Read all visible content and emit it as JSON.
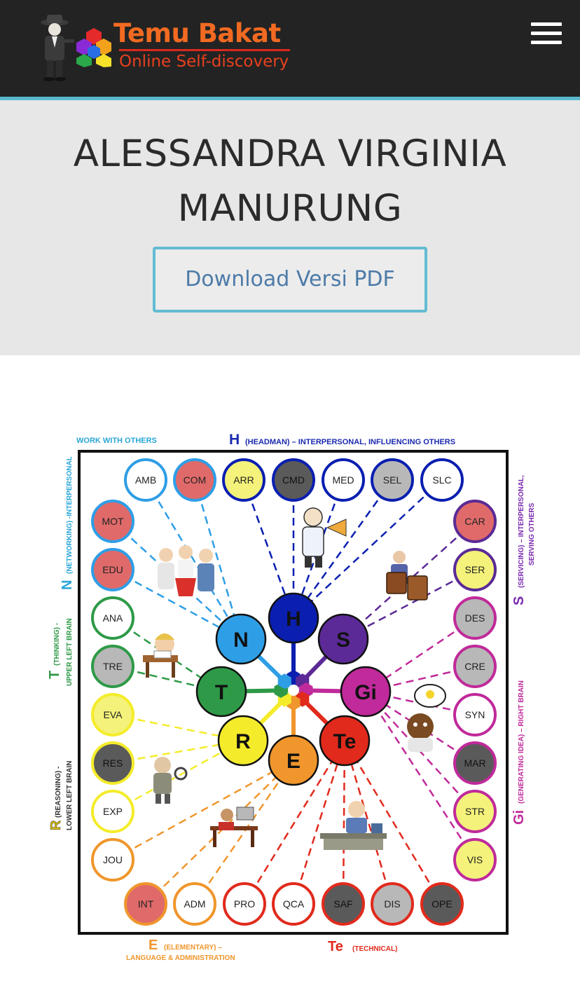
{
  "header": {
    "logo_title": "Temu Bakat",
    "logo_subtitle": "Online Self-discovery",
    "menu_icon": "hamburger-menu-icon"
  },
  "profile": {
    "name": "ALESSANDRA VIRGINIA MANURUNG",
    "download_label": "Download Versi PDF"
  },
  "colors": {
    "header_bg": "#232323",
    "accent": "#5ab8d0",
    "logo_orange": "#f26a21",
    "button_text": "#4d7ba8",
    "H": "#0a1fb0",
    "N": "#2e9ee6",
    "S": "#5b2a96",
    "Gi": "#c02a9a",
    "T": "#2e9a47",
    "R": "#f4ec2a",
    "E": "#f0962c",
    "Te": "#e12a1c",
    "gray": "#b8b8b8",
    "dark": "#5a5a5a",
    "red": "#e06a6a",
    "yellow": "#f4f27a"
  },
  "diagram": {
    "labels": {
      "top_left": "WORK WITH OTHERS",
      "top_letter": "H",
      "top_text": "(HEADMAN) – INTERPERSONAL, INFLUENCING OTHERS",
      "left_n_letter": "N",
      "left_n_text": "(NETWORKING) -INTERPERSONAL",
      "left_t_letter": "T",
      "left_t_text1": "(THINKING) -",
      "left_t_text2": "UPPER LEFT BRAIN",
      "left_r_letter": "R",
      "left_r_text1": "(REASONING) -",
      "left_r_text2": "LOWER LEFT BRAIN",
      "right_s_letter": "S",
      "right_s_text1": "(SERVICING) – INTERPERSONAL,",
      "right_s_text2": "SERVING OTHERS",
      "right_gi_letter": "Gi",
      "right_gi_text": "(GENERATING IDEA) – RIGHT BRAIN",
      "bottom_e_letter": "E",
      "bottom_e_text1": "(ELEMENTARY) –",
      "bottom_e_text2": "LANGUAGE & ADMINISTRATION",
      "bottom_te_letter": "Te",
      "bottom_te_text": "(TECHNICAL)"
    },
    "hub": [
      {
        "code": "H",
        "group": "H"
      },
      {
        "code": "N",
        "group": "N"
      },
      {
        "code": "S",
        "group": "S"
      },
      {
        "code": "T",
        "group": "T"
      },
      {
        "code": "Gi",
        "group": "Gi"
      },
      {
        "code": "R",
        "group": "R"
      },
      {
        "code": "Te",
        "group": "Te"
      },
      {
        "code": "E",
        "group": "E"
      }
    ],
    "top_row": [
      {
        "code": "AMB",
        "group": "N",
        "fill": "white"
      },
      {
        "code": "COM",
        "group": "N",
        "fill": "red"
      },
      {
        "code": "ARR",
        "group": "H",
        "fill": "yellow"
      },
      {
        "code": "CMD",
        "group": "H",
        "fill": "dark"
      },
      {
        "code": "MED",
        "group": "H",
        "fill": "white"
      },
      {
        "code": "SEL",
        "group": "H",
        "fill": "gray"
      },
      {
        "code": "SLC",
        "group": "H",
        "fill": "white"
      }
    ],
    "left_col": [
      {
        "code": "MOT",
        "group": "N",
        "fill": "red"
      },
      {
        "code": "EDU",
        "group": "N",
        "fill": "red"
      },
      {
        "code": "ANA",
        "group": "T",
        "fill": "white"
      },
      {
        "code": "TRE",
        "group": "T",
        "fill": "gray"
      },
      {
        "code": "EVA",
        "group": "R",
        "fill": "yellow"
      },
      {
        "code": "RES",
        "group": "R",
        "fill": "dark"
      },
      {
        "code": "EXP",
        "group": "R",
        "fill": "white"
      },
      {
        "code": "JOU",
        "group": "E",
        "fill": "white"
      }
    ],
    "right_col": [
      {
        "code": "CAR",
        "group": "S",
        "fill": "red"
      },
      {
        "code": "SER",
        "group": "S",
        "fill": "yellow"
      },
      {
        "code": "DES",
        "group": "Gi",
        "fill": "gray"
      },
      {
        "code": "CRE",
        "group": "Gi",
        "fill": "gray"
      },
      {
        "code": "SYN",
        "group": "Gi",
        "fill": "white"
      },
      {
        "code": "MAR",
        "group": "Gi",
        "fill": "dark"
      },
      {
        "code": "STR",
        "group": "Gi",
        "fill": "yellow"
      },
      {
        "code": "VIS",
        "group": "Gi",
        "fill": "yellow"
      }
    ],
    "bottom_row": [
      {
        "code": "INT",
        "group": "E",
        "fill": "red"
      },
      {
        "code": "ADM",
        "group": "E",
        "fill": "white"
      },
      {
        "code": "PRO",
        "group": "Te",
        "fill": "white"
      },
      {
        "code": "QCA",
        "group": "Te",
        "fill": "white"
      },
      {
        "code": "SAF",
        "group": "Te",
        "fill": "dark"
      },
      {
        "code": "DIS",
        "group": "Te",
        "fill": "gray"
      },
      {
        "code": "OPE",
        "group": "Te",
        "fill": "dark"
      }
    ]
  }
}
